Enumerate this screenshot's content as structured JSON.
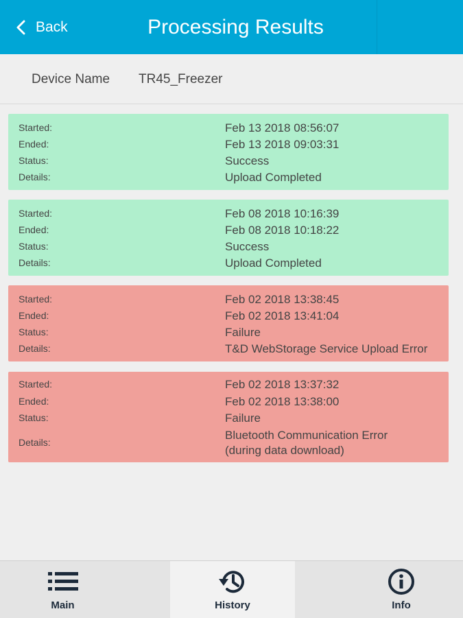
{
  "header": {
    "back_label": "Back",
    "title": "Processing Results",
    "color": "#00a6d6"
  },
  "device": {
    "label": "Device Name",
    "value": "TR45_Freezer"
  },
  "labels": {
    "started": "Started:",
    "ended": "Ended:",
    "status": "Status:",
    "details": "Details:"
  },
  "results": [
    {
      "started": "Feb 13 2018 08:56:07",
      "ended": "Feb 13 2018 09:03:31",
      "status": "Success",
      "details": "Upload Completed",
      "color": "#b0efcd"
    },
    {
      "started": "Feb 08 2018 10:16:39",
      "ended": "Feb 08 2018 10:18:22",
      "status": "Success",
      "details": "Upload Completed",
      "color": "#b0efcd"
    },
    {
      "started": "Feb 02 2018 13:38:45",
      "ended": "Feb 02 2018 13:41:04",
      "status": "Failure",
      "details": "T&D WebStorage Service Upload Error",
      "color": "#f0a09a"
    },
    {
      "started": "Feb 02 2018 13:37:32",
      "ended": "Feb 02 2018 13:38:00",
      "status": "Failure",
      "details_line1": "Bluetooth Communication Error",
      "details_line2": "(during data download)",
      "color": "#f0a09a"
    }
  ],
  "nav": {
    "main_label": "Main",
    "main_icon": "list-icon",
    "history_label": "History",
    "history_icon": "history-icon",
    "info_label": "Info",
    "info_icon": "info-icon",
    "active": "History"
  }
}
